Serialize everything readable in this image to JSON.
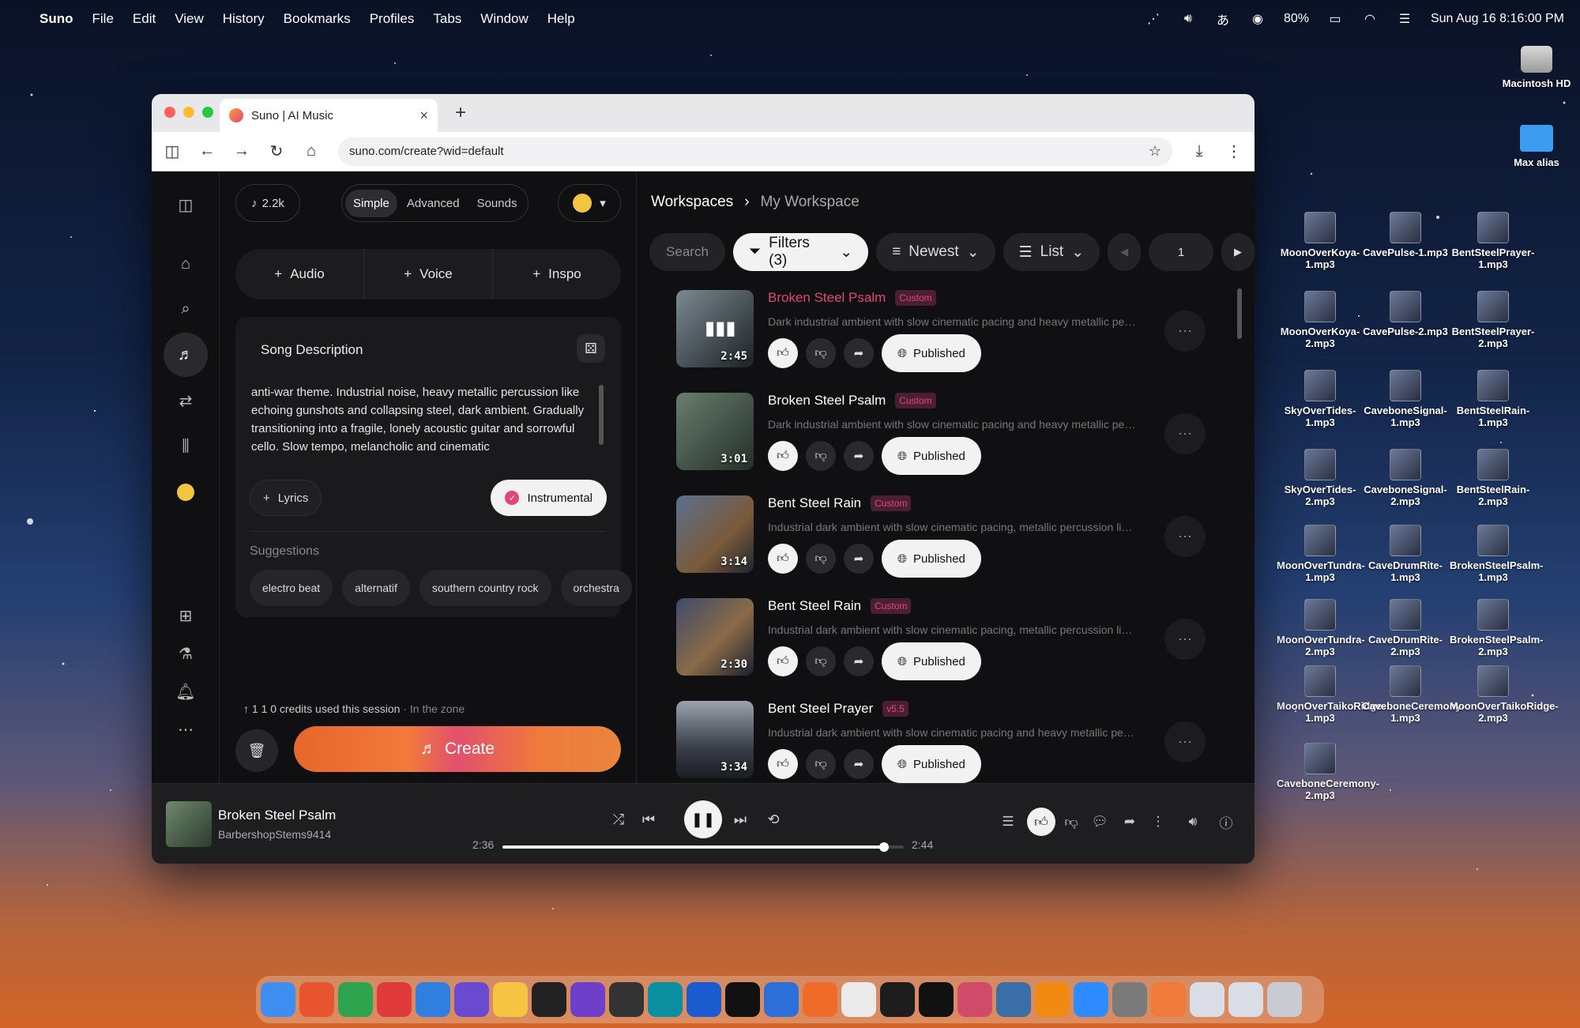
{
  "menubar": {
    "app": "Suno",
    "items": [
      "File",
      "Edit",
      "View",
      "History",
      "Bookmarks",
      "Profiles",
      "Tabs",
      "Window",
      "Help"
    ],
    "battery": "80%",
    "datetime": "Sun Aug 16  8:16:00 PM"
  },
  "desktop": {
    "drive": "Macintosh HD",
    "folder": "Max alias",
    "files": [
      "MoonOverKoya-1.mp3",
      "CavePulse-1.mp3",
      "BentSteelPrayer-1.mp3",
      "MoonOverKoya-2.mp3",
      "CavePulse-2.mp3",
      "BentSteelPrayer-2.mp3",
      "SkyOverTides-1.mp3",
      "CaveboneSignal-1.mp3",
      "BentSteelRain-1.mp3",
      "SkyOverTides-2.mp3",
      "CaveboneSignal-2.mp3",
      "BentSteelRain-2.mp3",
      "MoonOverTundra-1.mp3",
      "CaveDrumRite-1.mp3",
      "BrokenSteelPsalm-1.mp3",
      "MoonOverTundra-2.mp3",
      "CaveDrumRite-2.mp3",
      "BrokenSteelPsalm-2.mp3",
      "MoonOverTaikoRidge-1.mp3",
      "CaveboneCeremony-1.mp3",
      "MoonOverTaikoRidge-2.mp3",
      "CaveboneCeremony-2.mp3"
    ]
  },
  "browser": {
    "tab_title": "Suno | AI Music",
    "url": "suno.com/create?wid=default"
  },
  "left": {
    "credits_badge": "2.2k",
    "modes": [
      "Simple",
      "Advanced",
      "Sounds"
    ],
    "add_buttons": [
      "Audio",
      "Voice",
      "Inspo"
    ],
    "description_header": "Song Description",
    "description_text": "anti-war theme. Industrial noise, heavy metallic percussion like echoing gunshots and collapsing steel, dark ambient. Gradually transitioning into a fragile, lonely acoustic guitar and sorrowful cello. Slow tempo, melancholic and cinematic",
    "lyrics_label": "Lyrics",
    "instrumental_label": "Instrumental",
    "suggestions_label": "Suggestions",
    "suggestions": [
      "electro beat",
      "alternatif",
      "southern country rock",
      "orchestra"
    ],
    "credits_used": "1 1 0 credits used this session",
    "credits_status": "· In the zone",
    "create_label": "Create"
  },
  "right": {
    "breadcrumb_root": "Workspaces",
    "breadcrumb_current": "My Workspace",
    "search_placeholder": "Search",
    "filters_label": "Filters (3)",
    "sort_label": "Newest",
    "view_label": "List",
    "page": "1",
    "published_label": "Published",
    "songs": [
      {
        "title": "Broken Steel Psalm",
        "badge": "Custom",
        "desc": "Dark industrial ambient with slow cinematic pacing and heavy metallic percu...",
        "duration": "2:45",
        "playing": true
      },
      {
        "title": "Broken Steel Psalm",
        "badge": "Custom",
        "desc": "Dark industrial ambient with slow cinematic pacing and heavy metallic percu...",
        "duration": "3:01",
        "playing": false
      },
      {
        "title": "Bent Steel Rain",
        "badge": "Custom",
        "desc": "Industrial dark ambient with slow cinematic pacing, metallic percussion like di...",
        "duration": "3:14",
        "playing": false
      },
      {
        "title": "Bent Steel Rain",
        "badge": "Custom",
        "desc": "Industrial dark ambient with slow cinematic pacing, metallic percussion like di...",
        "duration": "2:30",
        "playing": false
      },
      {
        "title": "Bent Steel Prayer",
        "badge": "v5.5",
        "desc": "Industrial dark ambient with slow cinematic pacing and heavy metallic percu...",
        "duration": "3:34",
        "playing": false
      }
    ]
  },
  "player": {
    "title": "Broken Steel Psalm",
    "artist": "BarbershopStems9414",
    "elapsed": "2:36",
    "total": "2:44",
    "progress": 0.95
  },
  "colors": {
    "accent_pink": "#e0457b",
    "create_orange": "#f07a3a"
  }
}
